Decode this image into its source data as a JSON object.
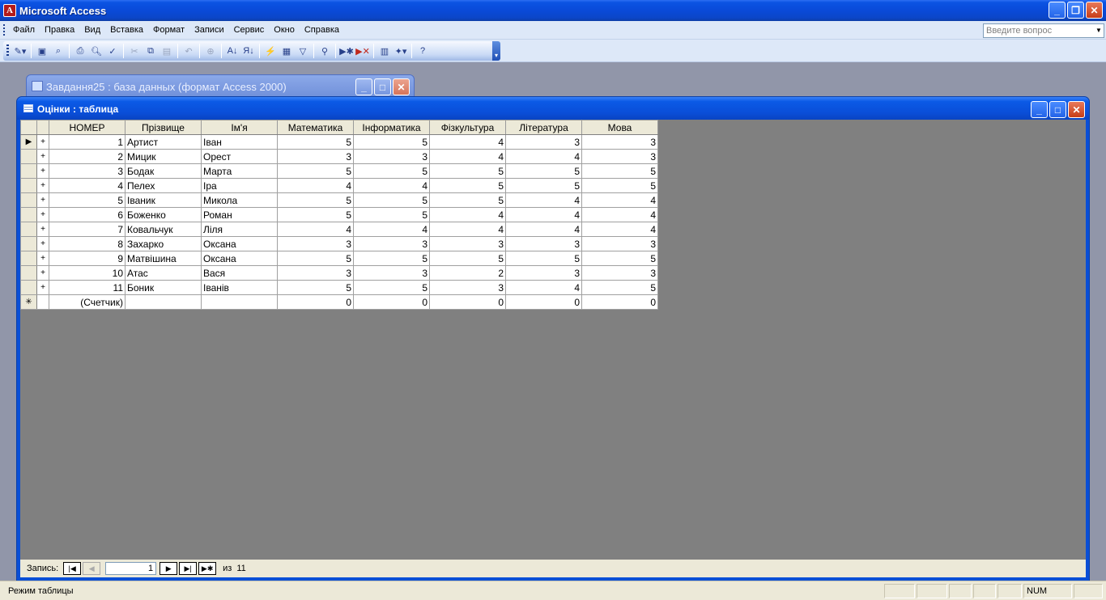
{
  "app": {
    "title": "Microsoft Access",
    "icon_letter": "A"
  },
  "menu": {
    "items": [
      "Файл",
      "Правка",
      "Вид",
      "Вставка",
      "Формат",
      "Записи",
      "Сервис",
      "Окно",
      "Справка"
    ],
    "help_placeholder": "Введите вопрос"
  },
  "toolbar": {
    "buttons": [
      "view-icon",
      "save-icon",
      "search-file-icon",
      "print-icon",
      "print-preview-icon",
      "spelling-icon",
      "cut-icon",
      "copy-icon",
      "paste-icon",
      "undo-icon",
      "hyperlink-icon",
      "sort-ascending-icon",
      "sort-descending-icon",
      "filter-by-selection-icon",
      "filter-by-form-icon",
      "apply-filter-icon",
      "find-icon",
      "new-record-icon",
      "delete-record-icon",
      "database-window-icon",
      "new-object-icon",
      "help-icon"
    ]
  },
  "db_window": {
    "title": "Завдання25 : база данных (формат Access 2000)"
  },
  "table_window": {
    "title": "Оцінки : таблица"
  },
  "grid": {
    "columns": [
      "НОМЕР",
      "Прізвище",
      "Ім'я",
      "Математика",
      "Інформатика",
      "Фізкультура",
      "Література",
      "Мова"
    ],
    "rows": [
      [
        "1",
        "Артист",
        "Іван",
        "5",
        "5",
        "4",
        "3",
        "3"
      ],
      [
        "2",
        "Мицик",
        "Орест",
        "3",
        "3",
        "4",
        "4",
        "3"
      ],
      [
        "3",
        "Бодак",
        "Марта",
        "5",
        "5",
        "5",
        "5",
        "5"
      ],
      [
        "4",
        "Пелех",
        "Іра",
        "4",
        "4",
        "5",
        "5",
        "5"
      ],
      [
        "5",
        "Іваник",
        "Микола",
        "5",
        "5",
        "5",
        "4",
        "4"
      ],
      [
        "6",
        "Боженко",
        "Роман",
        "5",
        "5",
        "4",
        "4",
        "4"
      ],
      [
        "7",
        "Ковальчук",
        "Ліля",
        "4",
        "4",
        "4",
        "4",
        "4"
      ],
      [
        "8",
        "Захарко",
        "Оксана",
        "3",
        "3",
        "3",
        "3",
        "3"
      ],
      [
        "9",
        "Матвішина",
        "Оксана",
        "5",
        "5",
        "5",
        "5",
        "5"
      ],
      [
        "10",
        "Атас",
        "Вася",
        "3",
        "3",
        "2",
        "3",
        "3"
      ],
      [
        "11",
        "Боник",
        "Іванів",
        "5",
        "5",
        "3",
        "4",
        "5"
      ]
    ],
    "new_row": [
      "(Счетчик)",
      "",
      "",
      "0",
      "0",
      "0",
      "0",
      "0"
    ],
    "current_row_marker": "▶",
    "new_row_marker": "✳",
    "expand_marker": "+"
  },
  "record_nav": {
    "label": "Запись:",
    "current": "1",
    "of_label": "из",
    "total": "11"
  },
  "status": {
    "text": "Режим таблицы",
    "num": "NUM"
  }
}
